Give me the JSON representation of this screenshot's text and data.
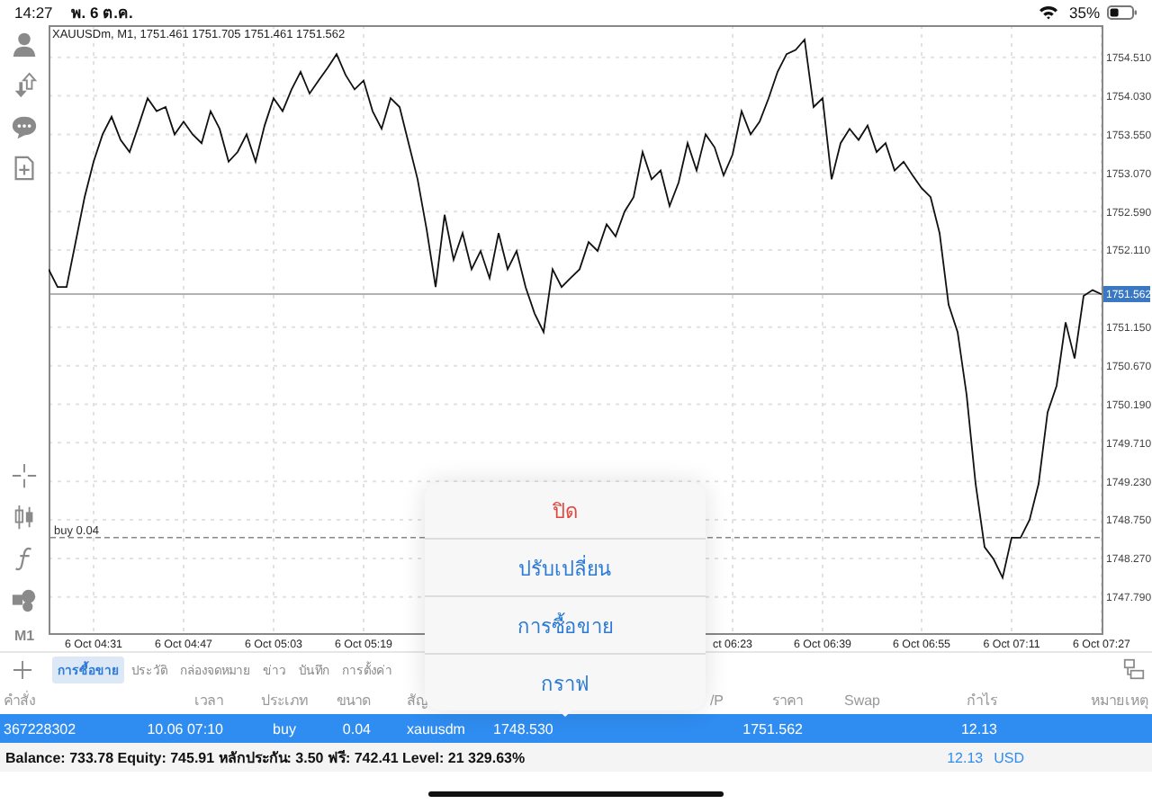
{
  "status_bar": {
    "time": "14:27",
    "date": "พ. 6 ต.ค.",
    "battery": "35%"
  },
  "toolbar": {
    "timeframe": "M1"
  },
  "chart": {
    "header": "XAUUSDm, M1, 1751.461 1751.705 1751.461 1751.562",
    "chart_data": {
      "type": "line",
      "grid": true,
      "ylim": [
        1747.34,
        1754.91
      ],
      "categories": [
        null,
        null,
        null,
        null,
        null,
        "6 Oct 04:31",
        null,
        null,
        null,
        null,
        null,
        null,
        null,
        null,
        null,
        "6 Oct 04:47",
        null,
        null,
        null,
        null,
        null,
        null,
        null,
        null,
        null,
        "6 Oct 05:03",
        null,
        null,
        null,
        null,
        null,
        null,
        null,
        null,
        null,
        "6 Oct 05:19",
        null,
        null,
        null,
        null,
        null,
        null,
        null,
        null,
        null,
        null,
        null,
        null,
        null,
        null,
        null,
        null,
        null,
        null,
        null,
        null,
        null,
        null,
        null,
        null,
        null,
        null,
        null,
        null,
        null,
        null,
        null,
        null,
        null,
        null,
        null,
        null,
        null,
        null,
        null,
        null,
        "ct 06:23",
        null,
        null,
        null,
        null,
        null,
        null,
        null,
        null,
        null,
        "6 Oct 06:39",
        null,
        null,
        null,
        null,
        null,
        null,
        null,
        null,
        null,
        null,
        "6 Oct 06:55",
        null,
        null,
        null,
        null,
        null,
        null,
        null,
        null,
        null,
        "6 Oct 07:11",
        null,
        null,
        null,
        null,
        null,
        null,
        null,
        null,
        null,
        "6 Oct 07:27"
      ],
      "yticks": [
        {
          "value": 1754.51,
          "label": "1754.510"
        },
        {
          "value": 1754.03,
          "label": "1754.030"
        },
        {
          "value": 1753.55,
          "label": "1753.550"
        },
        {
          "value": 1753.07,
          "label": "1753.070"
        },
        {
          "value": 1752.59,
          "label": "1752.590"
        },
        {
          "value": 1752.11,
          "label": "1752.110"
        },
        {
          "value": 1751.15,
          "label": "1751.150"
        },
        {
          "value": 1750.67,
          "label": "1750.670"
        },
        {
          "value": 1750.19,
          "label": "1750.190"
        },
        {
          "value": 1749.71,
          "label": "1749.710"
        },
        {
          "value": 1749.23,
          "label": "1749.230"
        },
        {
          "value": 1748.75,
          "label": "1748.750"
        },
        {
          "value": 1748.27,
          "label": "1748.270"
        },
        {
          "value": 1747.79,
          "label": "1747.790"
        }
      ],
      "series": [
        {
          "color": "#111111",
          "values": [
            1751.87,
            1751.65,
            1751.65,
            1752.21,
            1752.77,
            1753.21,
            1753.55,
            1753.77,
            1753.48,
            1753.33,
            1753.66,
            1754.0,
            1753.84,
            1753.89,
            1753.55,
            1753.71,
            1753.55,
            1753.44,
            1753.84,
            1753.62,
            1753.21,
            1753.33,
            1753.55,
            1753.21,
            1753.66,
            1754.0,
            1753.84,
            1754.11,
            1754.33,
            1754.06,
            1754.22,
            1754.38,
            1754.55,
            1754.29,
            1754.11,
            1754.22,
            1753.84,
            1753.62,
            1754.0,
            1753.89,
            1753.44,
            1752.99,
            1752.37,
            1751.65,
            1752.55,
            1751.99,
            1752.32,
            1751.87,
            1752.1,
            1751.76,
            1752.32,
            1751.87,
            1752.1,
            1751.65,
            1751.32,
            1751.09,
            1751.87,
            1751.65,
            1751.76,
            1751.87,
            1752.21,
            1752.1,
            1752.43,
            1752.28,
            1752.59,
            1752.77,
            1753.33,
            1752.99,
            1753.1,
            1752.66,
            1752.95,
            1753.44,
            1753.1,
            1753.55,
            1753.39,
            1753.04,
            1753.3,
            1753.84,
            1753.55,
            1753.71,
            1754.0,
            1754.33,
            1754.55,
            1754.6,
            1754.73,
            1753.89,
            1754.0,
            1752.99,
            1753.44,
            1753.62,
            1753.48,
            1753.66,
            1753.33,
            1753.44,
            1753.1,
            1753.21,
            1753.04,
            1752.88,
            1752.77,
            1752.32,
            1751.43,
            1751.09,
            1750.31,
            1749.2,
            1748.41,
            1748.26,
            1748.03,
            1748.53,
            1748.53,
            1748.75,
            1749.2,
            1750.09,
            1750.42,
            1751.21,
            1750.76,
            1751.54,
            1751.61,
            1751.56
          ]
        }
      ],
      "ref_lines": [
        {
          "axis": "y",
          "value": 1751.562,
          "label": "1751.562"
        },
        {
          "axis": "y",
          "value": 1748.53,
          "label": "buy 0.04"
        }
      ]
    }
  },
  "tabs": [
    {
      "label": "การซื้อขาย",
      "selected": true
    },
    {
      "label": "ประวัติ",
      "selected": false
    },
    {
      "label": "กล่องจดหมาย",
      "selected": false
    },
    {
      "label": "ข่าว",
      "selected": false
    },
    {
      "label": "บันทึก",
      "selected": false
    },
    {
      "label": "การตั้งค่า",
      "selected": false
    }
  ],
  "table": {
    "header": {
      "order": "คำสั่ง",
      "time": "เวลา",
      "type": "ประเภท",
      "volume": "ขนาด",
      "symbol": "สัญ",
      "tp": "/P",
      "price": "ราคา",
      "swap": "Swap",
      "profit": "กำไร",
      "comment": "หมายเหตุ"
    },
    "rows": [
      {
        "selected": true,
        "order": "367228302",
        "time": "10.06 07:10",
        "type": "buy",
        "volume": "0.04",
        "symbol": "xauusdm",
        "open_price": "1748.530",
        "price": "1751.562",
        "profit": "12.13"
      }
    ],
    "summary": {
      "text": "Balance: 733.78 Equity: 745.91 หลักประกัน: 3.50 ฟรี: 742.41 Level: 21 329.63%",
      "profit": "12.13",
      "currency": "USD"
    }
  },
  "popup_menu": {
    "items": [
      {
        "label": "ปิด",
        "kind": "destructive"
      },
      {
        "label": "ปรับเปลี่ยน",
        "kind": "default"
      },
      {
        "label": "การซื้อขาย",
        "kind": "default"
      },
      {
        "label": "กราฟ",
        "kind": "default"
      }
    ]
  }
}
